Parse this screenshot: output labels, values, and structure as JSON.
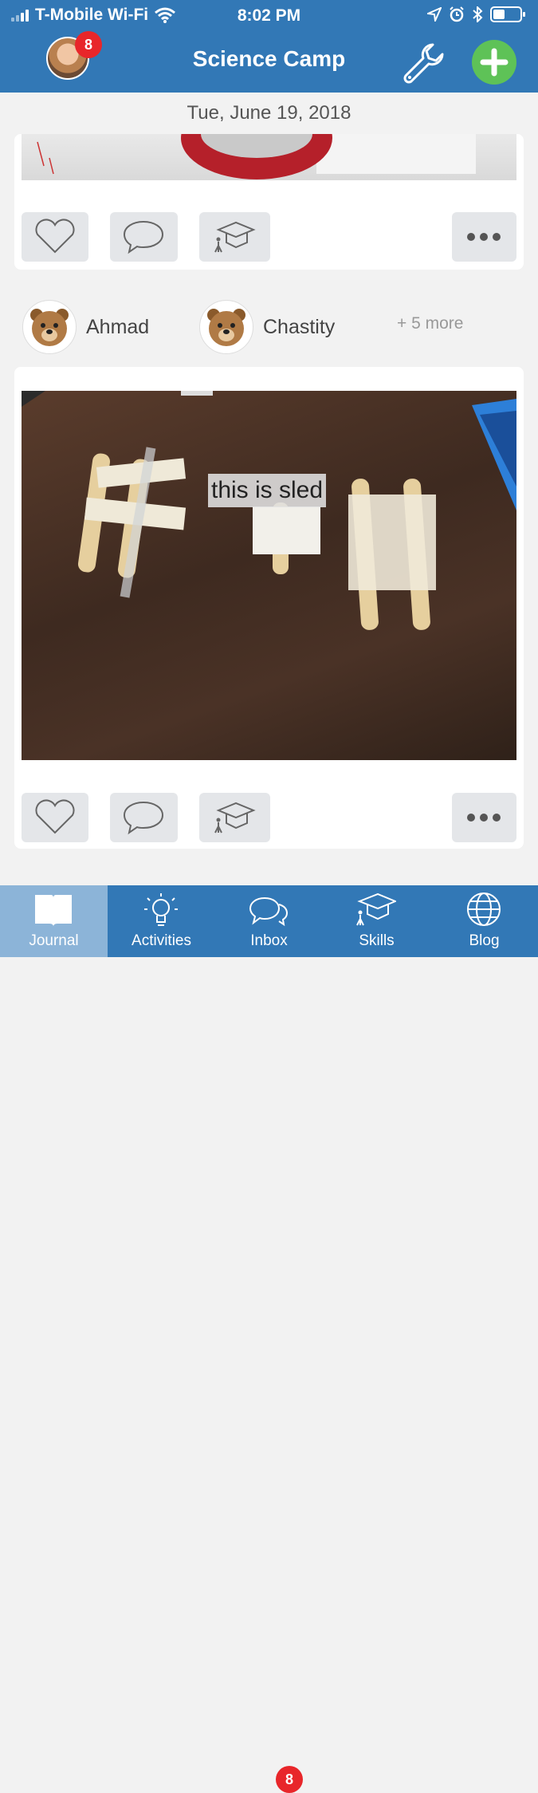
{
  "status_bar": {
    "carrier": "T-Mobile Wi-Fi",
    "time": "8:02 PM"
  },
  "nav": {
    "title": "Science Camp",
    "avatar_badge": "8",
    "avatar_icon": "profile-avatar",
    "settings_icon": "wrench-icon",
    "add_icon": "plus-icon",
    "accent_color": "#3278b6",
    "add_color": "#5ec257"
  },
  "feed": {
    "date": "Tue, June 19, 2018",
    "post1": {
      "actions": [
        "heart-icon",
        "comment-icon",
        "graduation-cap-icon",
        "more-icon"
      ]
    },
    "tags": {
      "students": [
        {
          "name": "Ahmad",
          "icon": "bear-face"
        },
        {
          "name": "Chastity",
          "icon": "bear-face"
        }
      ],
      "more": "+ 5 more"
    },
    "post2": {
      "caption": "this is sled",
      "actions": [
        "heart-icon",
        "comment-icon",
        "graduation-cap-icon",
        "more-icon"
      ]
    }
  },
  "tab_bar": {
    "active": "Journal",
    "tabs": [
      {
        "label": "Journal",
        "icon": "book-icon"
      },
      {
        "label": "Activities",
        "icon": "lightbulb-icon"
      },
      {
        "label": "Inbox",
        "icon": "chat-bubbles-icon",
        "badge": "8"
      },
      {
        "label": "Skills",
        "icon": "graduation-cap-icon"
      },
      {
        "label": "Blog",
        "icon": "globe-icon"
      }
    ]
  }
}
